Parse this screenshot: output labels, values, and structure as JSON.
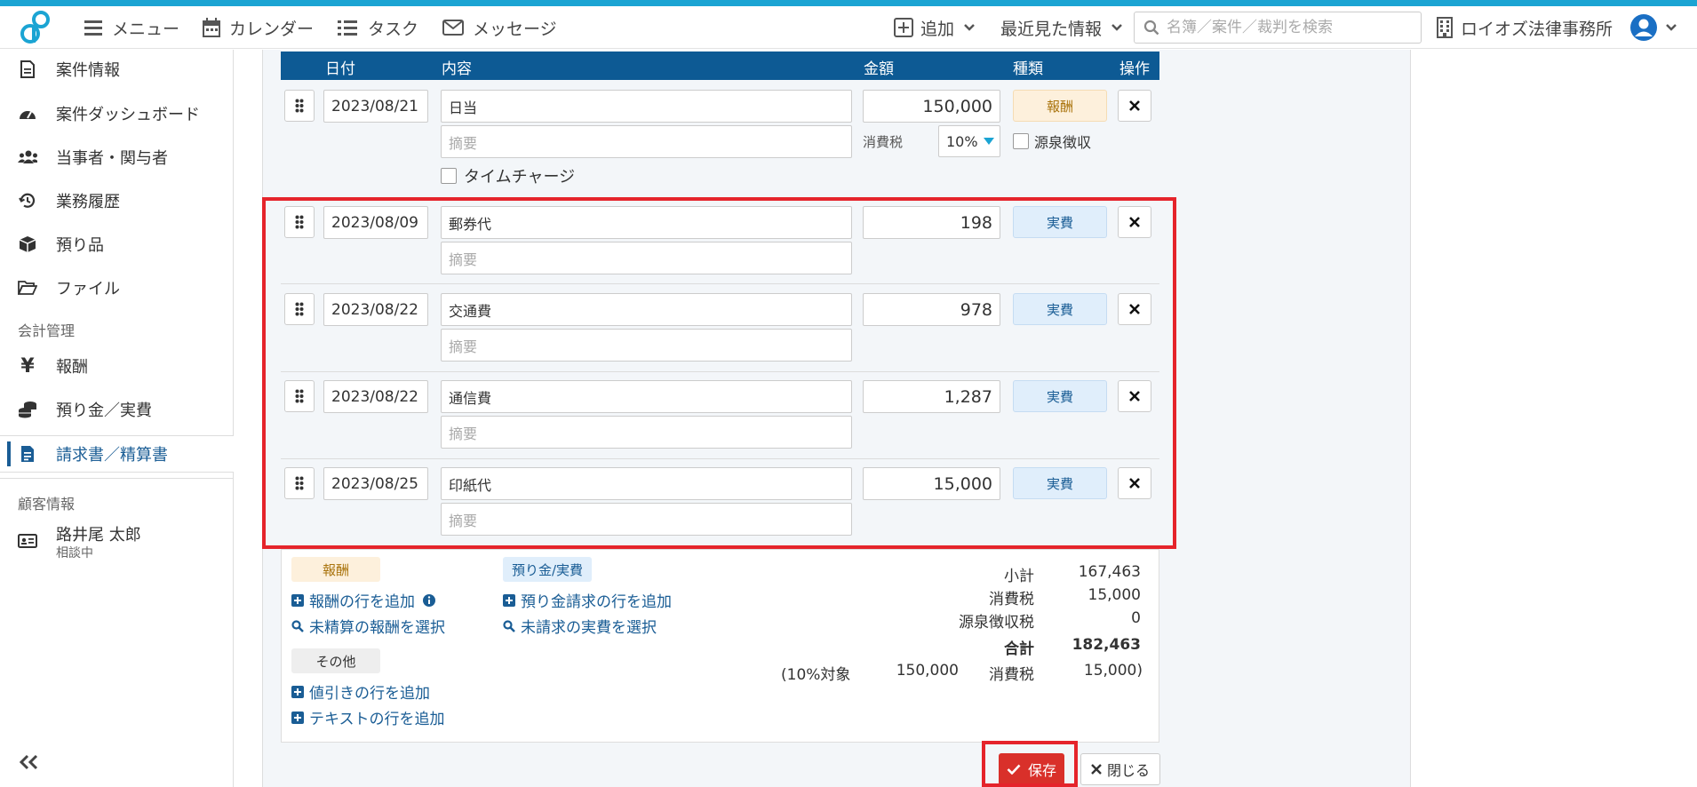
{
  "nav": {
    "menu": "メニュー",
    "calendar": "カレンダー",
    "task": "タスク",
    "message": "メッセージ",
    "add": "追加",
    "recent": "最近見た情報",
    "search_placeholder": "名簿／案件／裁判を検索",
    "office": "ロイオズ法律事務所"
  },
  "sidebar": {
    "items": [
      {
        "label": "案件情報",
        "icon": "document-icon"
      },
      {
        "label": "案件ダッシュボード",
        "icon": "dashboard-icon"
      },
      {
        "label": "当事者・関与者",
        "icon": "people-icon"
      },
      {
        "label": "業務履歴",
        "icon": "history-icon"
      },
      {
        "label": "預り品",
        "icon": "box-icon"
      },
      {
        "label": "ファイル",
        "icon": "folder-icon"
      }
    ],
    "section_accounting": "会計管理",
    "accounting": [
      {
        "label": "報酬",
        "icon": "yen-icon"
      },
      {
        "label": "預り金／実費",
        "icon": "coins-icon"
      },
      {
        "label": "請求書／精算書",
        "icon": "invoice-icon"
      }
    ],
    "section_client": "顧客情報",
    "client_name": "路井尾 太郎",
    "client_status": "相談中"
  },
  "table": {
    "headers": {
      "date": "日付",
      "content": "内容",
      "amount": "金額",
      "kind": "種類",
      "op": "操作"
    },
    "first_row": {
      "date": "2023/08/21",
      "content": "日当",
      "memo_placeholder": "摘要",
      "amount": "150,000",
      "kind": "報酬",
      "tax_label": "消費税",
      "tax_rate": "10%",
      "withholding": "源泉徴収",
      "timecharge": "タイムチャージ"
    },
    "rows": [
      {
        "date": "2023/08/09",
        "content": "郵券代",
        "memo": "摘要",
        "amount": "198",
        "kind": "実費"
      },
      {
        "date": "2023/08/22",
        "content": "交通費",
        "memo": "摘要",
        "amount": "978",
        "kind": "実費"
      },
      {
        "date": "2023/08/22",
        "content": "通信費",
        "memo": "摘要",
        "amount": "1,287",
        "kind": "実費"
      },
      {
        "date": "2023/08/25",
        "content": "印紙代",
        "memo": "摘要",
        "amount": "15,000",
        "kind": "実費"
      }
    ]
  },
  "footer": {
    "tag_fee": "報酬",
    "tag_deposit": "預り金/実費",
    "tag_other": "その他",
    "add_fee_row": "報酬の行を追加",
    "select_unsettled_fee": "未精算の報酬を選択",
    "add_deposit_row": "預り金請求の行を追加",
    "select_unbilled_expense": "未請求の実費を選択",
    "add_discount_row": "値引きの行を追加",
    "add_text_row": "テキストの行を追加",
    "subtotal_label": "小計",
    "subtotal": "167,463",
    "tax_label": "消費税",
    "tax": "15,000",
    "withholding_label": "源泉徴収税",
    "withholding": "0",
    "total_label": "合計",
    "total": "182,463",
    "breakdown_prefix": "(10%対象",
    "breakdown_base": "150,000",
    "breakdown_tax_label": "消費税",
    "breakdown_tax": "15,000)"
  },
  "buttons": {
    "save": "保存",
    "close": "閉じる"
  }
}
